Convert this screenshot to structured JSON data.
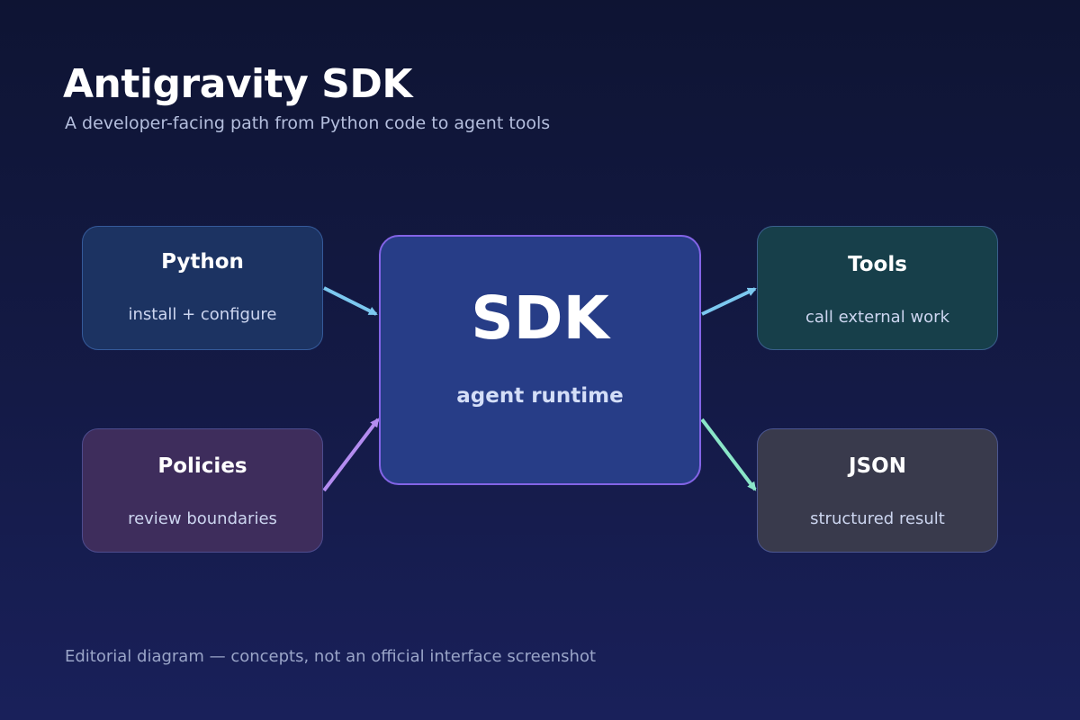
{
  "header": {
    "title": "Antigravity SDK",
    "subtitle": "A developer-facing path from Python code to agent tools"
  },
  "nodes": {
    "python": {
      "title": "Python",
      "description": "install + configure"
    },
    "policies": {
      "title": "Policies",
      "description": "review boundaries"
    },
    "sdk": {
      "title": "SDK",
      "description": "agent runtime"
    },
    "tools": {
      "title": "Tools",
      "description": "call external work"
    },
    "json": {
      "title": "JSON",
      "description": "structured result"
    }
  },
  "edges": [
    {
      "from": "Python",
      "to": "SDK",
      "color": "#7cc8f0"
    },
    {
      "from": "Policies",
      "to": "SDK",
      "color": "#b48cf0"
    },
    {
      "from": "SDK",
      "to": "Tools",
      "color": "#7cc8f0"
    },
    {
      "from": "SDK",
      "to": "JSON",
      "color": "#8ae6c8"
    }
  ],
  "footer": {
    "note": "Editorial diagram — concepts, not an official interface screenshot"
  }
}
